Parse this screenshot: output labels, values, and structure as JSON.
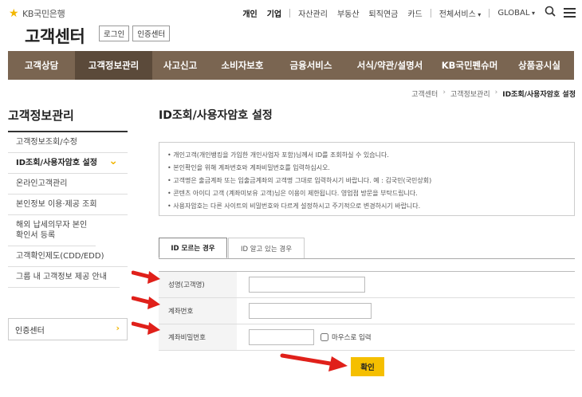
{
  "header": {
    "brand_text": "KB국민은행",
    "site_title": "고객센터",
    "login_label": "로그인",
    "cert_label": "인증센터",
    "top_nav_primary": [
      "개인",
      "기업"
    ],
    "top_nav_secondary": [
      "자산관리",
      "부동산",
      "퇴직연금",
      "카드"
    ],
    "all_services_label": "전체서비스",
    "global_label": "GLOBAL",
    "icons": [
      "search-icon",
      "menu-icon"
    ]
  },
  "gnb": {
    "items": [
      "고객상담",
      "고객정보관리",
      "사고신고",
      "소비자보호",
      "금융서비스",
      "서식/약관/설명서",
      "KB국민펜슈머",
      "상품공시실"
    ],
    "active_index": 1,
    "bg_color": "#7a6551",
    "active_color": "#5b4a3a"
  },
  "breadcrumb": [
    "고객센터",
    "고객정보관리",
    "ID조회/사용자암호 설정"
  ],
  "sidebar": {
    "title": "고객정보관리",
    "items": [
      "고객정보조회/수정",
      "ID조회/사용자암호 설정",
      "온라인고객관리",
      "본인정보 이용·제공 조회",
      "해외 납세의무자 본인확인서 등록",
      "고객확인제도(CDD/EDD)",
      "그룹 내 고객정보 제공 안내"
    ],
    "active_index": 1,
    "cert_link": "인증센터"
  },
  "main": {
    "page_title": "ID조회/사용자암호 설정",
    "notices": [
      "개인고객(개인뱅킹을 가입한 개인사업자 포함)님께서 ID를 조회하실 수 있습니다.",
      "본인확인을 위해 계좌번호와 계좌비밀번호를 입력하십시오.",
      "고객명은 출금계좌 또는 입출금계좌의 고객명 그대로 입력하시기 바랍니다. 예 : 김국민(국민상회)",
      "콘텐츠 아이디 고객 (계좌미보유 고객)님은 이용이 제한됩니다. 영업점 방문을 부탁드립니다.",
      "사용자암호는 다른 사이트의 비밀번호와 다르게 설정하시고 주기적으로 변경하시기 바랍니다."
    ],
    "tabs": [
      "ID 모르는 경우",
      "ID 알고 있는 경우"
    ],
    "active_tab": 0,
    "form": {
      "name_label": "성명(고객명)",
      "name_value": "",
      "account_label": "계좌번호",
      "account_value": "",
      "password_label": "계좌비밀번호",
      "password_value": "",
      "mouse_input_label": "마우스로 입력"
    },
    "confirm_label": "확인",
    "accent_color": "#f5bf00",
    "annotation_arrow_color": "#e0201a"
  }
}
